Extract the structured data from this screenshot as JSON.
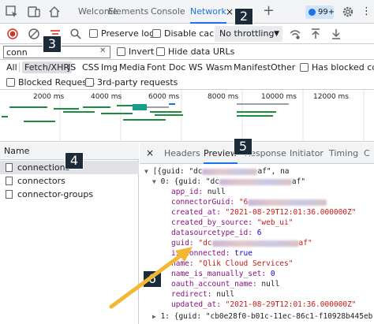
{
  "tabbar": {
    "tabs": [
      "Welcome",
      "Elements",
      "Console",
      "Network"
    ],
    "active_tab": "Network",
    "close_symbol": "×",
    "plus_symbol": "+",
    "issues_badge": "99+"
  },
  "callouts": [
    "2",
    "3",
    "4",
    "5",
    "6"
  ],
  "toolbar": {
    "preserve_log": "Preserve log",
    "disable_cache": "Disable cache",
    "throttling": "No throttling",
    "dropdown_arrow": "▼"
  },
  "filter": {
    "value": "conn",
    "clear": "✕",
    "invert": "Invert",
    "hide_data_urls": "Hide data URLs"
  },
  "types": [
    "All",
    "Fetch/XHR",
    "JS",
    "CSS",
    "Img",
    "Media",
    "Font",
    "Doc",
    "WS",
    "Wasm",
    "Manifest",
    "Other"
  ],
  "selected_type": "Fetch/XHR",
  "has_blocked_cookies": "Has blocked cook",
  "blocked_requests": "Blocked Requests",
  "third_party": "3rd-party requests",
  "timeline": {
    "ticks": [
      "2000 ms",
      "4000 ms",
      "6000 ms",
      "8000 ms",
      "10000 ms",
      "12000 ms"
    ]
  },
  "requests": {
    "header": "Name",
    "items": [
      "connections",
      "connectors",
      "connector-groups"
    ],
    "selected": "connections"
  },
  "detail": {
    "close": "×",
    "tabs": [
      "Headers",
      "Preview",
      "Response",
      "Initiator",
      "Timing",
      "C"
    ],
    "active_tab": "Preview"
  },
  "json": {
    "line0": "[{guid: \"dc",
    "line0_end": "af\", na",
    "line1_key": "0: {guid: \"dc",
    "line1_end": "af\"",
    "app_id": "app_id:",
    "app_id_val": "null",
    "connector_guid": "connectorGuid:",
    "connector_guid_val": "\"6",
    "created_at": "created_at:",
    "created_at_val": "\"2021-08-29T12:01:36.000000Z\"",
    "created_by": "created_by_source:",
    "created_by_val": "\"web_ui\"",
    "ds_type": "datasourcetype_id:",
    "ds_type_val": "6",
    "guid": "guid:",
    "guid_val": "\"dc",
    "guid_end": "af\"",
    "is_connected": "is_connected:",
    "is_connected_val": "true",
    "name": "name:",
    "name_val": "\"Qlik Cloud Services\"",
    "manual": "name_is_manually_set:",
    "manual_val": "0",
    "oauth": "oauth_account_name:",
    "oauth_val": "null",
    "redirect": "redirect:",
    "redirect_val": "null",
    "updated_at": "updated_at:",
    "updated_at_val": "\"2021-08-29T12:01:36.000000Z\"",
    "line_next": "1: {guid: \"cb0e28f0-b01c-11ec-86c1-f10928b445eb\""
  },
  "colors": {
    "accent": "#1a73e8",
    "callout_bg": "#1c2b3a",
    "arrow": "#f4b731",
    "record": "#d93025"
  }
}
